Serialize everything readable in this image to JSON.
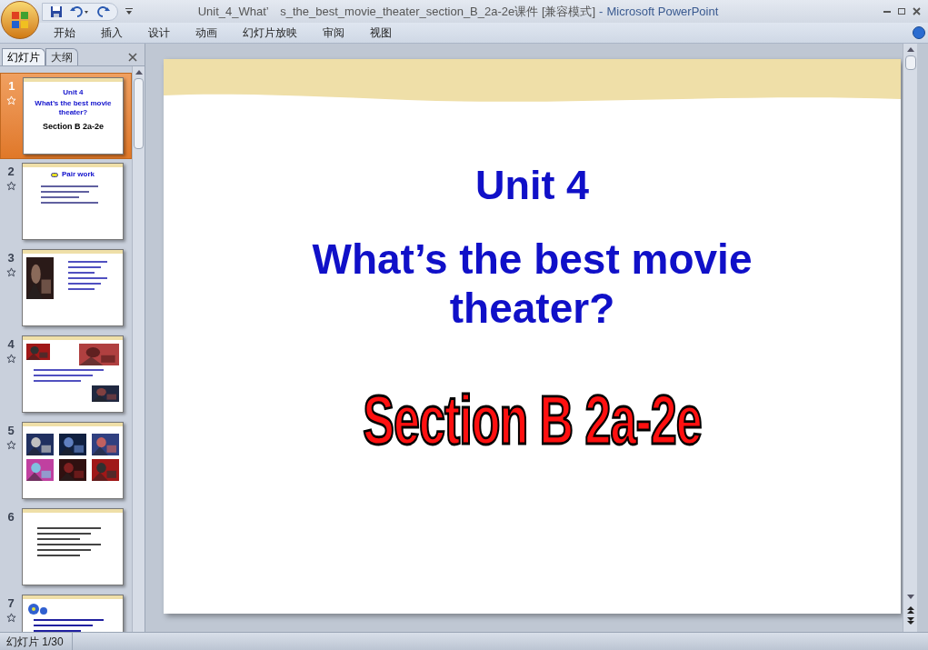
{
  "window": {
    "doc_name": "Unit_4_What’　s_the_best_movie_theater_section_B_2a-2e课件 [兼容模式]",
    "separator": "-",
    "app_name": "Microsoft PowerPoint"
  },
  "ribbon_tabs": [
    {
      "label": "开始"
    },
    {
      "label": "插入"
    },
    {
      "label": "设计"
    },
    {
      "label": "动画"
    },
    {
      "label": "幻灯片放映"
    },
    {
      "label": "审阅"
    },
    {
      "label": "视图"
    }
  ],
  "panel_tabs": [
    {
      "label": "幻灯片",
      "selected": true
    },
    {
      "label": "大纲",
      "selected": false
    }
  ],
  "slides": [
    {
      "number": "1",
      "selected": true,
      "has_animation": true,
      "kind": "title",
      "texts": [
        "Unit 4",
        "What’s the best movie theater?",
        "Section B 2a-2e"
      ]
    },
    {
      "number": "2",
      "selected": false,
      "has_animation": true,
      "kind": "dialog",
      "texts": [
        "Pair work"
      ]
    },
    {
      "number": "3",
      "selected": false,
      "has_animation": true,
      "kind": "portrait"
    },
    {
      "number": "4",
      "selected": false,
      "has_animation": true,
      "kind": "photos"
    },
    {
      "number": "5",
      "selected": false,
      "has_animation": true,
      "kind": "gallery"
    },
    {
      "number": "6",
      "selected": false,
      "has_animation": false,
      "kind": "bullets"
    },
    {
      "number": "7",
      "selected": false,
      "has_animation": true,
      "kind": "flower"
    }
  ],
  "slide": {
    "title": "Unit 4",
    "subtitle": "What’s the best movie theater?",
    "section": "Section B 2a-2e"
  },
  "status_bar": {
    "slide_counter": "幻灯片 1/30"
  }
}
